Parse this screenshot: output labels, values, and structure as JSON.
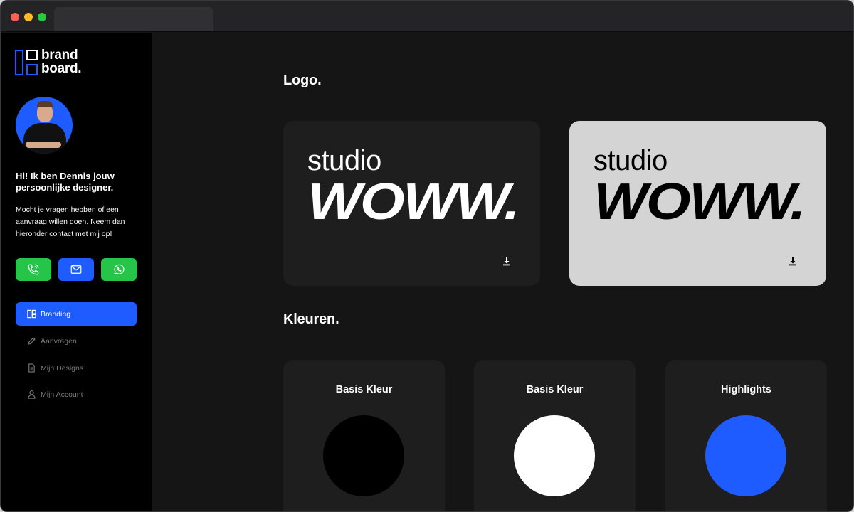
{
  "app": {
    "logo_text": "brand\nboard.",
    "colors": {
      "accent": "#1f5cff",
      "green": "#27c44a",
      "bg": "#151515",
      "sidebar": "#000000"
    }
  },
  "sidebar": {
    "greeting": "Hi! Ik ben Dennis jouw persoonlijke designer.",
    "intro": "Mocht je vragen hebben of een aanvraag willen doen. Neem dan hieronder contact met mij op!",
    "contact": [
      {
        "name": "phone-icon"
      },
      {
        "name": "mail-icon"
      },
      {
        "name": "whatsapp-icon"
      }
    ],
    "nav": [
      {
        "label": "Branding",
        "icon": "layout-icon",
        "active": true
      },
      {
        "label": "Aanvragen",
        "icon": "pencil-icon",
        "active": false
      },
      {
        "label": "Mijn Designs",
        "icon": "document-icon",
        "active": false
      },
      {
        "label": "Mijn Account",
        "icon": "user-icon",
        "active": false
      }
    ]
  },
  "main": {
    "logo_section_title": "Logo.",
    "logos": [
      {
        "line1": "studio",
        "line2": "WOWW.",
        "variant": "dark"
      },
      {
        "line1": "studio",
        "line2": "WOWW.",
        "variant": "light"
      }
    ],
    "colors_section_title": "Kleuren.",
    "colors": [
      {
        "title": "Basis Kleur",
        "hex": "#000000"
      },
      {
        "title": "Basis Kleur",
        "hex": "#ffffff"
      },
      {
        "title": "Highlights",
        "hex": "#1f5cff"
      }
    ]
  }
}
